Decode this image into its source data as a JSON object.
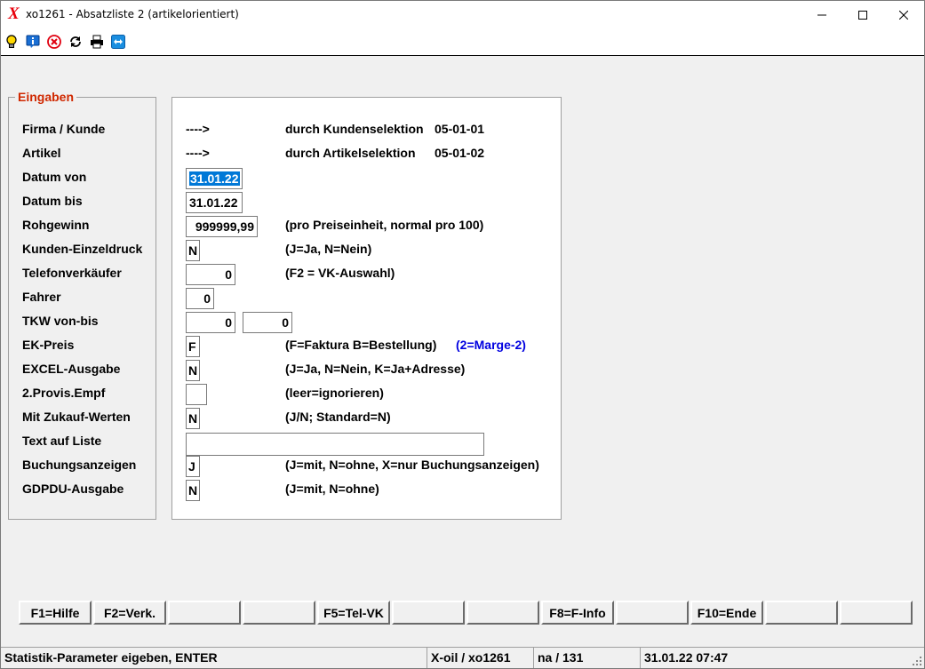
{
  "window": {
    "app_logo": "X",
    "title": "xo1261 - Absatzliste 2 (artikelorientiert)",
    "controls": {
      "minimize": "minimize-icon",
      "maximize": "maximize-icon",
      "close": "close-icon"
    }
  },
  "toolbar": {
    "icons": [
      "lightbulb-icon",
      "info-icon",
      "stop-icon",
      "refresh-icon",
      "print-icon",
      "remote-icon"
    ]
  },
  "group": {
    "title": "Eingaben",
    "labels": [
      "Firma / Kunde",
      "Artikel",
      "Datum von",
      "Datum bis",
      "Rohgewinn",
      "Kunden-Einzeldruck",
      "Telefonverkäufer",
      "Fahrer",
      "TKW von-bis",
      "EK-Preis",
      "EXCEL-Ausgabe",
      "2.Provis.Empf",
      "Mit Zukauf-Werten",
      "Text auf Liste",
      "Buchungsanzeigen",
      "GDPDU-Ausgabe"
    ]
  },
  "form": {
    "firma": {
      "arrow": "---->",
      "text": "durch Kundenselektion",
      "code": "05-01-01"
    },
    "artikel": {
      "arrow": "---->",
      "text": "durch Artikelselektion",
      "code": "05-01-02"
    },
    "datum_von": "31.01.22",
    "datum_bis": "31.01.22",
    "rohgewinn": {
      "value": "999999,99",
      "hint": "(pro Preiseinheit, normal pro 100)"
    },
    "kunden_einzeldruck": {
      "value": "N",
      "hint": "(J=Ja, N=Nein)"
    },
    "telefonverkaeufer": {
      "value": "0",
      "hint": "(F2 = VK-Auswahl)"
    },
    "fahrer": "0",
    "tkw": {
      "from": "0",
      "to": "0"
    },
    "ek_preis": {
      "value": "F",
      "hint": "(F=Faktura B=Bestellung)",
      "hint2": "(2=Marge-2)"
    },
    "excel": {
      "value": "N",
      "hint": "(J=Ja, N=Nein, K=Ja+Adresse)"
    },
    "provis": {
      "value": "",
      "hint": "(leer=ignorieren)"
    },
    "zukauf": {
      "value": "N",
      "hint": "(J/N; Standard=N)"
    },
    "text_liste": "",
    "buchung": {
      "value": "J",
      "hint": "(J=mit, N=ohne, X=nur Buchungsanzeigen)"
    },
    "gdpdu": {
      "value": "N",
      "hint": "(J=mit, N=ohne)"
    }
  },
  "fkeys": [
    "F1=Hilfe",
    "F2=Verk.",
    "",
    "",
    "F5=Tel-VK",
    "",
    "",
    "F8=F-Info",
    "",
    "F10=Ende",
    "",
    ""
  ],
  "status": {
    "message": "Statistik-Parameter eigeben, ENTER",
    "system": "X-oil / xo1261",
    "user": "na / 131",
    "datetime": "31.01.22 07:47"
  },
  "colors": {
    "group_title": "#d02800",
    "selection": "#0078d7",
    "hint_blue": "#0000e0",
    "logo": "#e8000b"
  }
}
